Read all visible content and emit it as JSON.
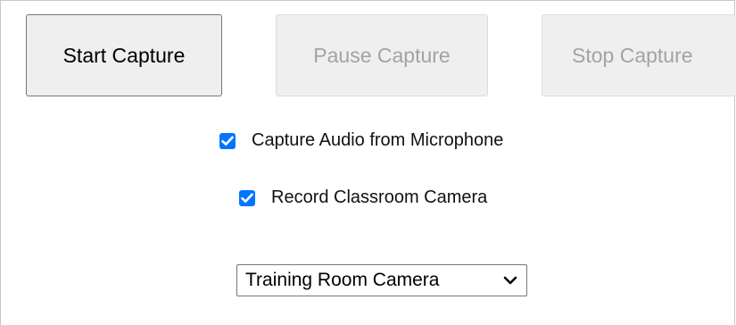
{
  "buttons": {
    "start_label": "Start Capture",
    "pause_label": "Pause Capture",
    "stop_label": "Stop Capture"
  },
  "options": {
    "audio_label": "Capture Audio from Microphone",
    "audio_checked": true,
    "camera_label": "Record Classroom Camera",
    "camera_checked": true
  },
  "camera_select": {
    "selected": "Training Room Camera"
  },
  "colors": {
    "checkbox_accent": "#0075ff",
    "button_bg": "#efefef",
    "disabled_text": "#a3a3a3"
  },
  "icons": {
    "check": "check-icon",
    "dropdown": "chevron-down-icon"
  }
}
